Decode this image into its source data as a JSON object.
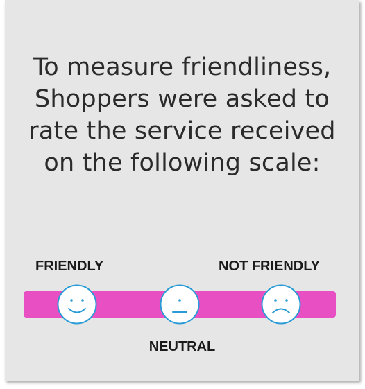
{
  "intro": {
    "line1": "To measure friendliness,",
    "line2": "Shoppers were asked to",
    "line3": "rate the service received",
    "line4": "on the following scale:"
  },
  "scale": {
    "left_label": "FRIENDLY",
    "right_label": "NOT FRIENDLY",
    "middle_label": "NEUTRAL",
    "icons": [
      "smiling-face-icon",
      "neutral-face-icon",
      "frowning-face-icon"
    ],
    "bar_color": "#e84fc3",
    "face_fill": "#ffffff",
    "face_stroke": "#2a9bd6"
  }
}
